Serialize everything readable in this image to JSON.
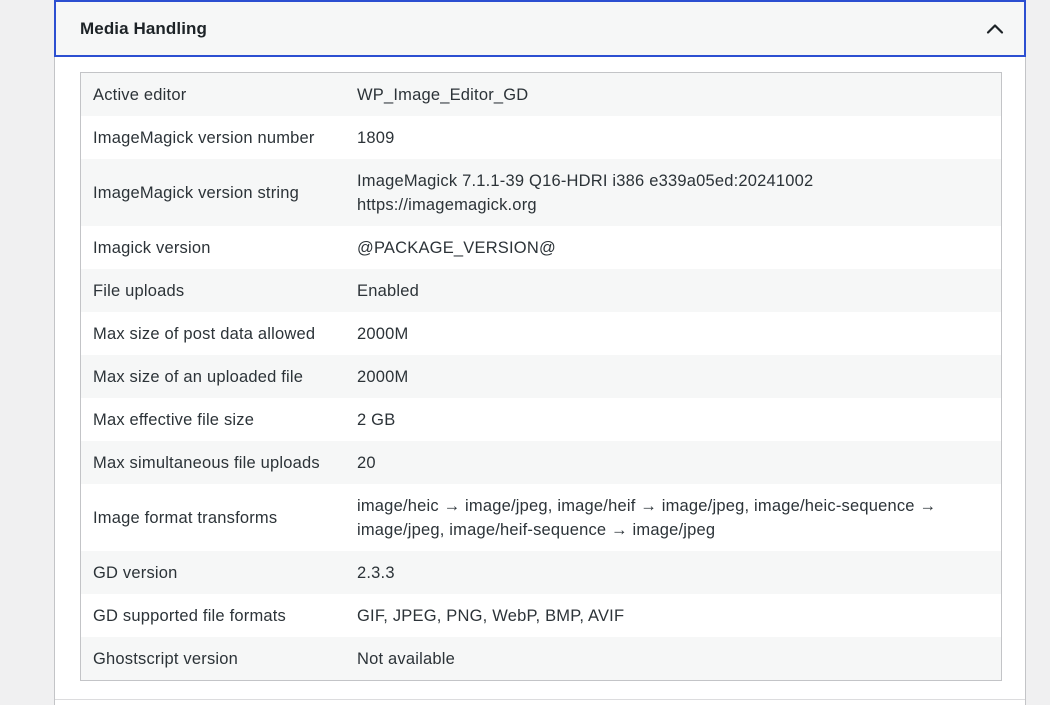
{
  "section": {
    "title": "Media Handling",
    "expanded": true
  },
  "rows": [
    {
      "label": "Active editor",
      "value": [
        "WP_Image_Editor_GD"
      ]
    },
    {
      "label": "ImageMagick version number",
      "value": [
        "1809"
      ]
    },
    {
      "label": "ImageMagick version string",
      "value": [
        "ImageMagick 7.1.1-39 Q16-HDRI i386 e339a05ed:20241002",
        "https://imagemagick.org"
      ]
    },
    {
      "label": "Imagick version",
      "value": [
        "@PACKAGE_VERSION@"
      ]
    },
    {
      "label": "File uploads",
      "value": [
        "Enabled"
      ]
    },
    {
      "label": "Max size of post data allowed",
      "value": [
        "2000M"
      ]
    },
    {
      "label": "Max size of an uploaded file",
      "value": [
        "2000M"
      ]
    },
    {
      "label": "Max effective file size",
      "value": [
        "2 GB"
      ]
    },
    {
      "label": "Max simultaneous file uploads",
      "value": [
        "20"
      ]
    },
    {
      "label": "Image format transforms",
      "value": [
        "image/heic → image/jpeg, image/heif → image/jpeg, image/heic-sequence →",
        "image/jpeg, image/heif-sequence → image/jpeg"
      ]
    },
    {
      "label": "GD version",
      "value": [
        "2.3.3"
      ]
    },
    {
      "label": "GD supported file formats",
      "value": [
        "GIF, JPEG, PNG, WebP, BMP, AVIF"
      ]
    },
    {
      "label": "Ghostscript version",
      "value": [
        "Not available"
      ]
    }
  ],
  "icons": {
    "toggle": "chevron-up-icon"
  },
  "colors": {
    "focus_border": "#2c4fd1",
    "header_bg": "#f6f7f7",
    "stripe": "#f6f7f7",
    "text": "#2c3338"
  }
}
